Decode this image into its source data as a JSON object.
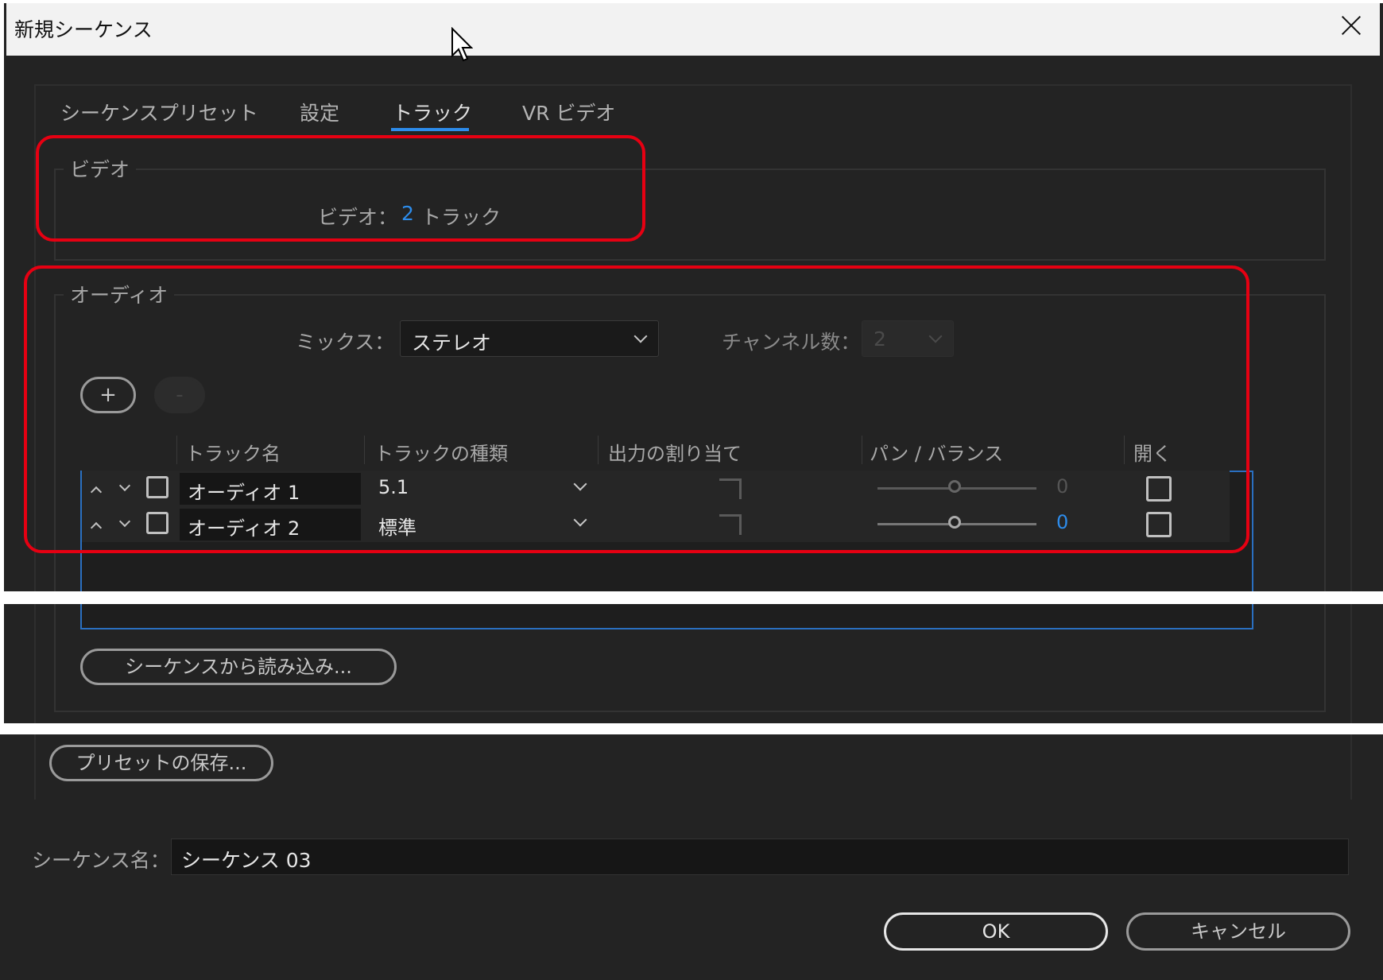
{
  "window": {
    "title": "新規シーケンス"
  },
  "tabs": [
    {
      "label": "シーケンスプリセット",
      "active": false
    },
    {
      "label": "設定",
      "active": false
    },
    {
      "label": "トラック",
      "active": true
    },
    {
      "label": "VR ビデオ",
      "active": false
    }
  ],
  "video": {
    "group_label": "ビデオ",
    "tracks_label": "ビデオ：",
    "tracks_value": "2",
    "tracks_unit": "トラック"
  },
  "audio": {
    "group_label": "オーディオ",
    "mix_label": "ミックス：",
    "mix_value": "ステレオ",
    "channels_label": "チャンネル数：",
    "channels_value": "2",
    "add_button": "+",
    "remove_button": "-",
    "columns": [
      "トラック名",
      "トラックの種類",
      "出力の割り当て",
      "パン / バランス",
      "開く"
    ],
    "tracks": [
      {
        "name": "オーディオ 1",
        "type": "5.1",
        "pan_value": "0"
      },
      {
        "name": "オーディオ 2",
        "type": "標準",
        "pan_value": "0"
      }
    ],
    "load_from_sequence_button": "シーケンスから読み込み..."
  },
  "save_preset_button": "プリセットの保存...",
  "sequence_name": {
    "label": "シーケンス名：",
    "value": "シーケンス 03"
  },
  "ok_button": "OK",
  "cancel_button": "キャンセル",
  "colors": {
    "accent": "#2d8ceb",
    "highlight": "#e60012",
    "background": "#232323"
  }
}
